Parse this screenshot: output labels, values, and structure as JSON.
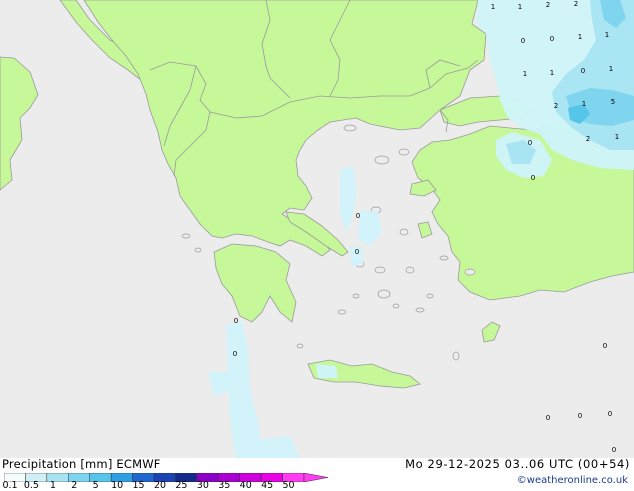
{
  "header": {
    "title_left": "Precipitation [mm] ECMWF",
    "title_right": "Mo 29-12-2025 03..06 UTC (00+54)",
    "credit": "©weatheronline.co.uk"
  },
  "legend": {
    "labels": [
      "0.1",
      "0.5",
      "1",
      "2",
      "5",
      "10",
      "15",
      "20",
      "25",
      "30",
      "35",
      "40",
      "45",
      "50"
    ],
    "colors": [
      "#f5fcfc",
      "#cfeef6",
      "#a9e3f2",
      "#7dd4ee",
      "#56c5ea",
      "#2f9fe4",
      "#1f66d0",
      "#1b43b4",
      "#122a8e",
      "#8a00c6",
      "#ac00d2",
      "#cc00dc",
      "#e800e6",
      "#ff3cf2"
    ]
  },
  "map": {
    "colors": {
      "sea": "#ececec",
      "land": "#c6f89a",
      "border": "#9a9a9a"
    },
    "values": [
      {
        "text": "1",
        "lon": 493,
        "lat": 6
      },
      {
        "text": "1",
        "lon": 520,
        "lat": 6
      },
      {
        "text": "2",
        "lon": 548,
        "lat": 4
      },
      {
        "text": "2",
        "lon": 576,
        "lat": 3
      },
      {
        "text": "0",
        "lon": 523,
        "lat": 40
      },
      {
        "text": "0",
        "lon": 552,
        "lat": 38
      },
      {
        "text": "1",
        "lon": 580,
        "lat": 36
      },
      {
        "text": "1",
        "lon": 607,
        "lat": 34
      },
      {
        "text": "1",
        "lon": 525,
        "lat": 73
      },
      {
        "text": "1",
        "lon": 552,
        "lat": 72
      },
      {
        "text": "0",
        "lon": 583,
        "lat": 70
      },
      {
        "text": "1",
        "lon": 611,
        "lat": 68
      },
      {
        "text": "2",
        "lon": 556,
        "lat": 105
      },
      {
        "text": "1",
        "lon": 584,
        "lat": 103
      },
      {
        "text": "5",
        "lon": 613,
        "lat": 101
      },
      {
        "text": "0",
        "lon": 530,
        "lat": 142
      },
      {
        "text": "2",
        "lon": 588,
        "lat": 138
      },
      {
        "text": "1",
        "lon": 617,
        "lat": 136
      },
      {
        "text": "0",
        "lon": 533,
        "lat": 177
      },
      {
        "text": "0",
        "lon": 358,
        "lat": 215
      },
      {
        "text": "0",
        "lon": 357,
        "lat": 251
      },
      {
        "text": "0",
        "lon": 236,
        "lat": 320
      },
      {
        "text": "0",
        "lon": 235,
        "lat": 353
      },
      {
        "text": "0",
        "lon": 605,
        "lat": 345
      },
      {
        "text": "0",
        "lon": 548,
        "lat": 417
      },
      {
        "text": "0",
        "lon": 580,
        "lat": 415
      },
      {
        "text": "0",
        "lon": 610,
        "lat": 413
      },
      {
        "text": "0",
        "lon": 614,
        "lat": 449
      }
    ]
  }
}
